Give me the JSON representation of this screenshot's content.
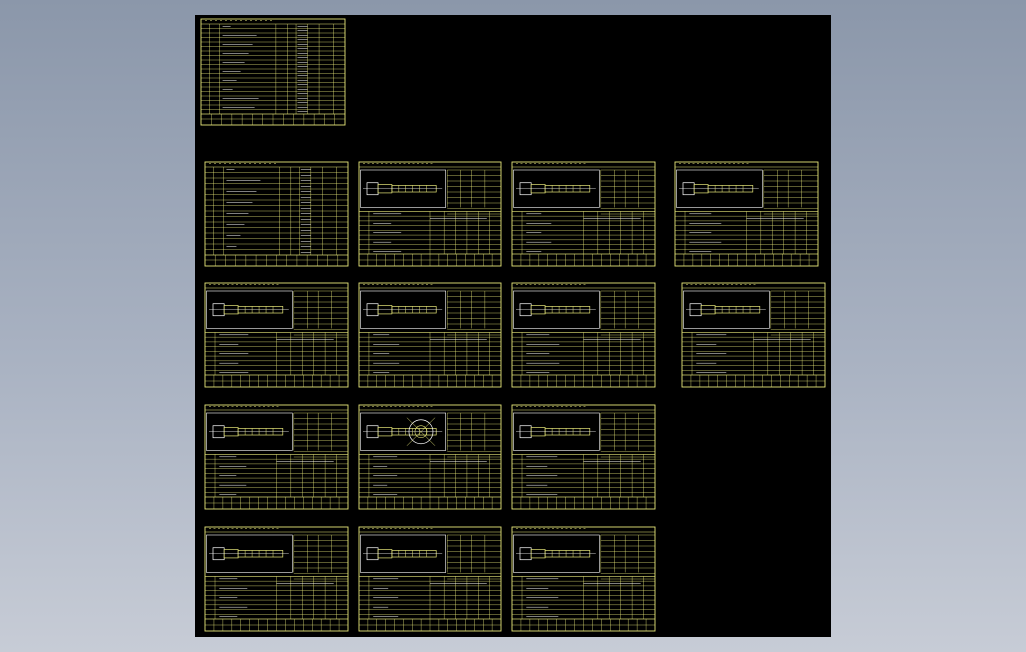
{
  "app": {
    "view": "CAD model space",
    "background": "#000000",
    "line_color": "#e8e87a",
    "highlight_color": "#ffffff"
  },
  "sheets": [
    {
      "id": "index-sheet",
      "kind": "index-table"
    },
    {
      "id": "sheet-r1-c1",
      "kind": "table"
    },
    {
      "id": "sheet-r1-c2",
      "kind": "process-card"
    },
    {
      "id": "sheet-r1-c3",
      "kind": "process-card"
    },
    {
      "id": "sheet-r1-c4",
      "kind": "process-card"
    },
    {
      "id": "sheet-r2-c1",
      "kind": "process-card"
    },
    {
      "id": "sheet-r2-c2",
      "kind": "process-card"
    },
    {
      "id": "sheet-r2-c3",
      "kind": "process-card"
    },
    {
      "id": "sheet-r2-c4",
      "kind": "process-card"
    },
    {
      "id": "sheet-r3-c1",
      "kind": "process-card"
    },
    {
      "id": "sheet-r3-c2",
      "kind": "process-card-section"
    },
    {
      "id": "sheet-r3-c3",
      "kind": "process-card"
    },
    {
      "id": "sheet-r4-c1",
      "kind": "process-card"
    },
    {
      "id": "sheet-r4-c2",
      "kind": "process-card"
    },
    {
      "id": "sheet-r4-c3",
      "kind": "process-card"
    }
  ]
}
